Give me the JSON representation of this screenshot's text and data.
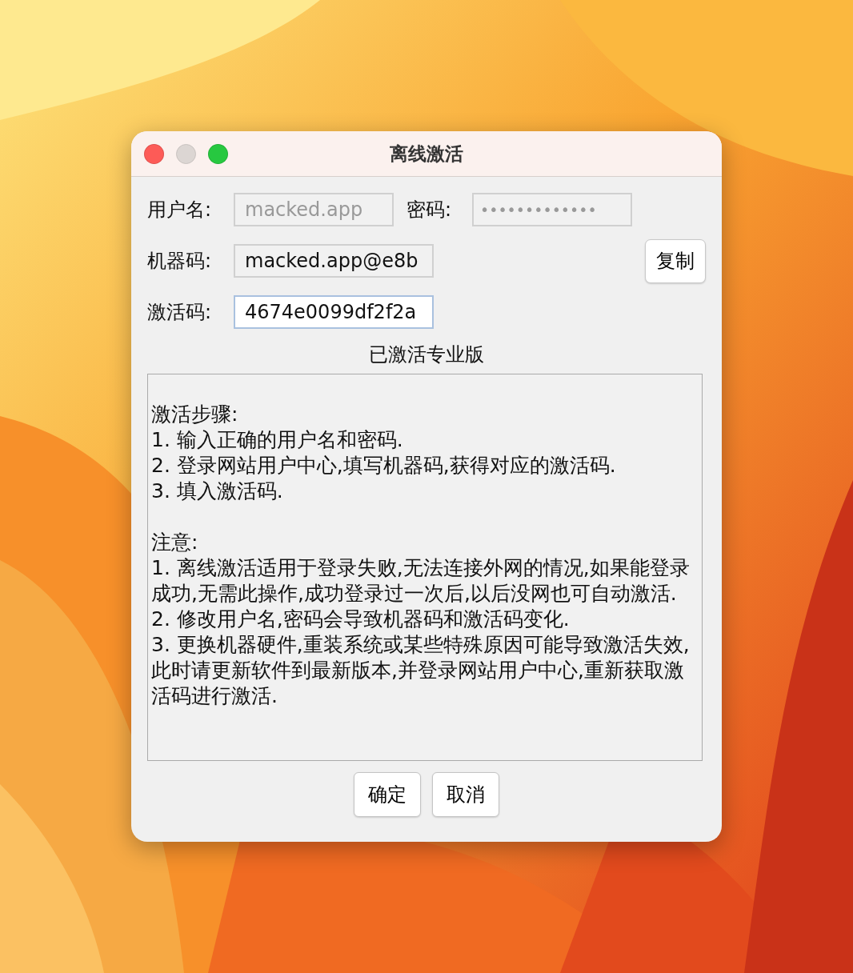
{
  "window": {
    "title": "离线激活"
  },
  "traffic_lights": [
    {
      "kind": "close",
      "disabled": false
    },
    {
      "kind": "minimize",
      "disabled": true
    },
    {
      "kind": "zoom",
      "disabled": false
    }
  ],
  "credentials": [
    {
      "label": "用户名:",
      "value": "macked.app",
      "disabled": true
    },
    {
      "label": "密码:",
      "value": "•••••••••••••",
      "disabled": true
    }
  ],
  "machine_code": {
    "label": "机器码:",
    "value": "macked.app@e8b",
    "copy_button": "复制"
  },
  "activation_code": {
    "label": "激活码:",
    "value": "4674e0099df2f2a",
    "focused": true
  },
  "status": "已激活专业版",
  "instructions": [
    {
      "heading": "激活步骤:",
      "items": [
        "1. 输入正确的用户名和密码.",
        "2. 登录网站用户中心,填写机器码,获得对应的激活码.",
        "3. 填入激活码."
      ]
    },
    {
      "heading": "注意:",
      "items": [
        "1. 离线激活适用于登录失败,无法连接外网的情况,如果能登录成功,无需此操作,成功登录过一次后,以后没网也可自动激活.",
        "2. 修改用户名,密码会导致机器码和激活码变化.",
        "3. 更换机器硬件,重装系统或某些特殊原因可能导致激活失效,此时请更新软件到最新版本,并登录网站用户中心,重新获取激活码进行激活."
      ]
    }
  ],
  "buttons": [
    {
      "label": "确定"
    },
    {
      "label": "取消"
    }
  ]
}
